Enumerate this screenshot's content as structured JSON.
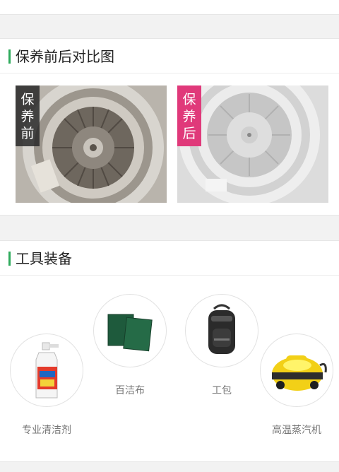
{
  "compare": {
    "title": "保养前后对比图",
    "before_tag": [
      "保",
      "养",
      "前"
    ],
    "after_tag": [
      "保",
      "养",
      "后"
    ]
  },
  "tools": {
    "title": "工具装备",
    "items": [
      {
        "label": "专业清洁剂",
        "icon": "detergent-bottle-icon"
      },
      {
        "label": "百洁布",
        "icon": "scouring-pad-icon"
      },
      {
        "label": "工包",
        "icon": "tool-backpack-icon"
      },
      {
        "label": "高温蒸汽机",
        "icon": "steam-cleaner-icon"
      }
    ]
  },
  "colors": {
    "accent": "#2eaa5c",
    "after_tag": "#e0397a",
    "background": "#f2f2f2"
  }
}
